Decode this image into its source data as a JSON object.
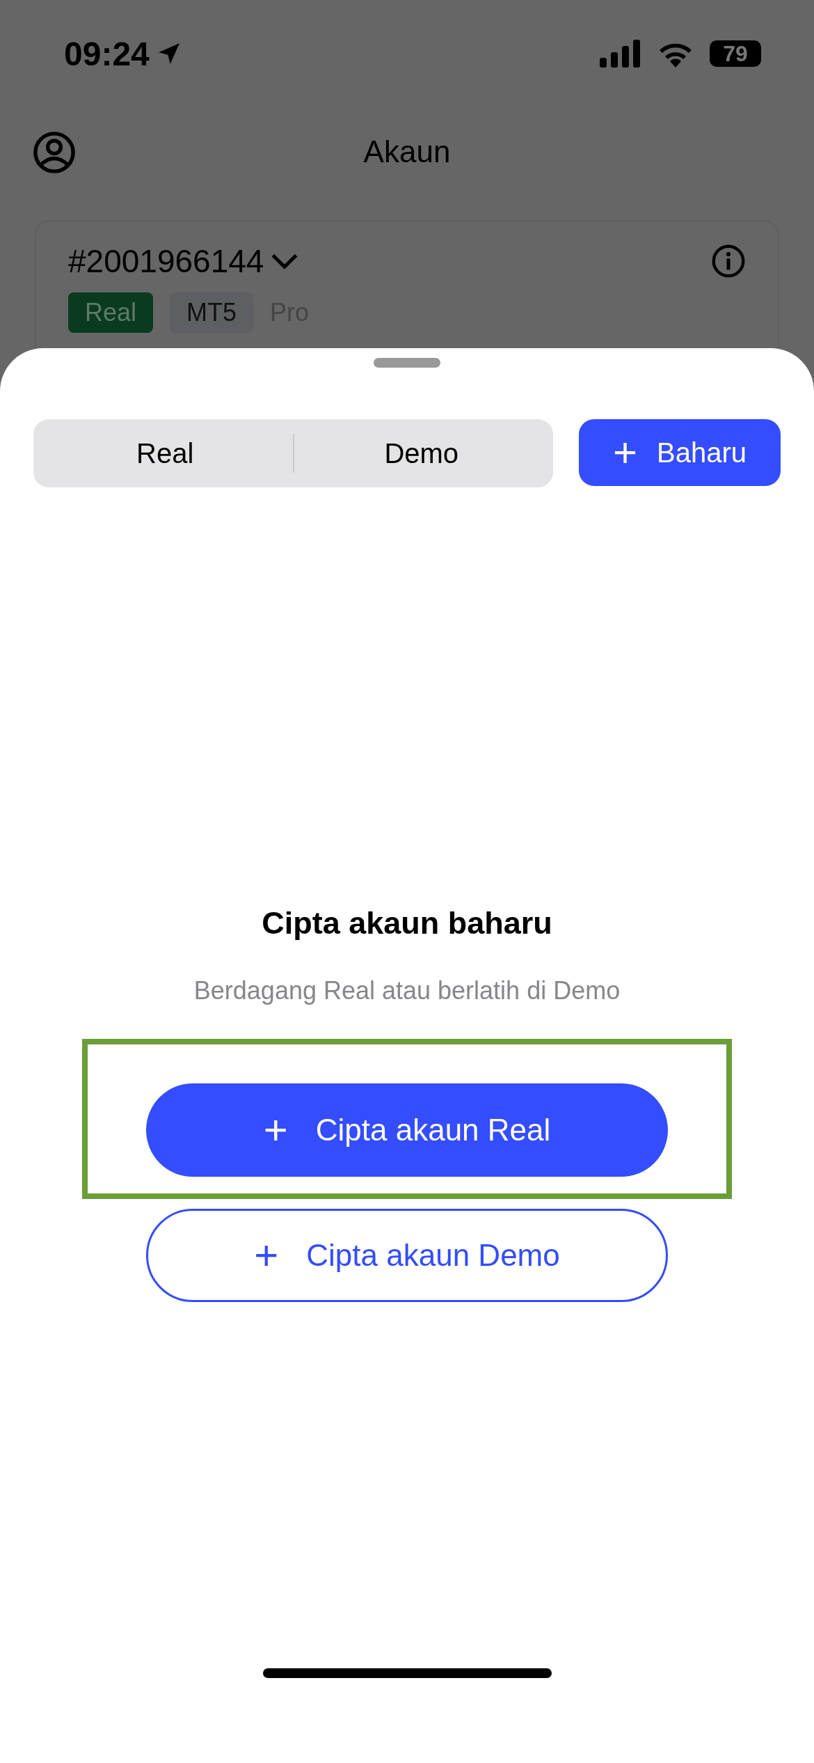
{
  "status_bar": {
    "time": "09:24",
    "battery": "79"
  },
  "header": {
    "title": "Akaun"
  },
  "account_card": {
    "number": "#2001966144",
    "tags": [
      {
        "label": "Real",
        "kind": "real"
      },
      {
        "label": "MT5",
        "kind": "platform"
      },
      {
        "label": "Pro",
        "kind": "plain"
      }
    ]
  },
  "sheet": {
    "tabs": [
      {
        "label": "Real",
        "selected": false
      },
      {
        "label": "Demo",
        "selected": false
      }
    ],
    "new_button": {
      "icon": "+",
      "label": "Baharu"
    },
    "empty_state": {
      "title": "Cipta akaun baharu",
      "subtitle": "Berdagang Real atau berlatih di Demo"
    },
    "create_buttons": [
      {
        "icon": "+",
        "label": "Cipta akaun Real",
        "kind": "filled",
        "highlighted": true
      },
      {
        "icon": "+",
        "label": "Cipta akaun Demo",
        "kind": "outline",
        "highlighted": false
      }
    ]
  }
}
